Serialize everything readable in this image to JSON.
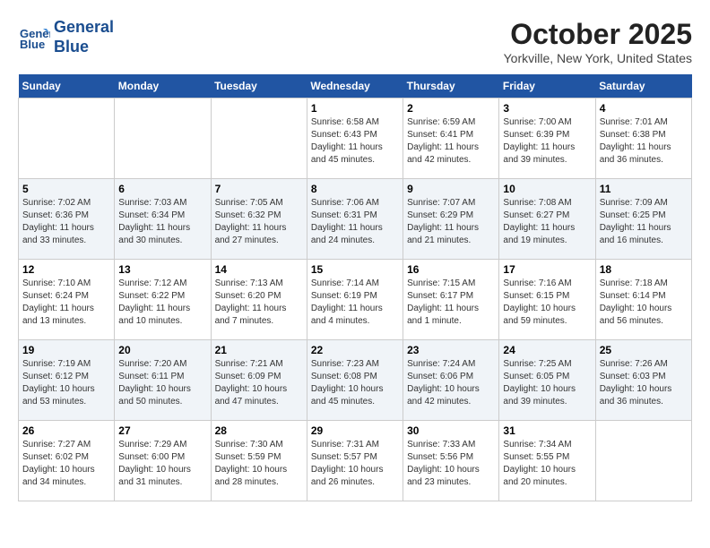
{
  "header": {
    "logo_line1": "General",
    "logo_line2": "Blue",
    "month": "October 2025",
    "location": "Yorkville, New York, United States"
  },
  "days_of_week": [
    "Sunday",
    "Monday",
    "Tuesday",
    "Wednesday",
    "Thursday",
    "Friday",
    "Saturday"
  ],
  "weeks": [
    [
      {
        "day": "",
        "info": ""
      },
      {
        "day": "",
        "info": ""
      },
      {
        "day": "",
        "info": ""
      },
      {
        "day": "1",
        "info": "Sunrise: 6:58 AM\nSunset: 6:43 PM\nDaylight: 11 hours\nand 45 minutes."
      },
      {
        "day": "2",
        "info": "Sunrise: 6:59 AM\nSunset: 6:41 PM\nDaylight: 11 hours\nand 42 minutes."
      },
      {
        "day": "3",
        "info": "Sunrise: 7:00 AM\nSunset: 6:39 PM\nDaylight: 11 hours\nand 39 minutes."
      },
      {
        "day": "4",
        "info": "Sunrise: 7:01 AM\nSunset: 6:38 PM\nDaylight: 11 hours\nand 36 minutes."
      }
    ],
    [
      {
        "day": "5",
        "info": "Sunrise: 7:02 AM\nSunset: 6:36 PM\nDaylight: 11 hours\nand 33 minutes."
      },
      {
        "day": "6",
        "info": "Sunrise: 7:03 AM\nSunset: 6:34 PM\nDaylight: 11 hours\nand 30 minutes."
      },
      {
        "day": "7",
        "info": "Sunrise: 7:05 AM\nSunset: 6:32 PM\nDaylight: 11 hours\nand 27 minutes."
      },
      {
        "day": "8",
        "info": "Sunrise: 7:06 AM\nSunset: 6:31 PM\nDaylight: 11 hours\nand 24 minutes."
      },
      {
        "day": "9",
        "info": "Sunrise: 7:07 AM\nSunset: 6:29 PM\nDaylight: 11 hours\nand 21 minutes."
      },
      {
        "day": "10",
        "info": "Sunrise: 7:08 AM\nSunset: 6:27 PM\nDaylight: 11 hours\nand 19 minutes."
      },
      {
        "day": "11",
        "info": "Sunrise: 7:09 AM\nSunset: 6:25 PM\nDaylight: 11 hours\nand 16 minutes."
      }
    ],
    [
      {
        "day": "12",
        "info": "Sunrise: 7:10 AM\nSunset: 6:24 PM\nDaylight: 11 hours\nand 13 minutes."
      },
      {
        "day": "13",
        "info": "Sunrise: 7:12 AM\nSunset: 6:22 PM\nDaylight: 11 hours\nand 10 minutes."
      },
      {
        "day": "14",
        "info": "Sunrise: 7:13 AM\nSunset: 6:20 PM\nDaylight: 11 hours\nand 7 minutes."
      },
      {
        "day": "15",
        "info": "Sunrise: 7:14 AM\nSunset: 6:19 PM\nDaylight: 11 hours\nand 4 minutes."
      },
      {
        "day": "16",
        "info": "Sunrise: 7:15 AM\nSunset: 6:17 PM\nDaylight: 11 hours\nand 1 minute."
      },
      {
        "day": "17",
        "info": "Sunrise: 7:16 AM\nSunset: 6:15 PM\nDaylight: 10 hours\nand 59 minutes."
      },
      {
        "day": "18",
        "info": "Sunrise: 7:18 AM\nSunset: 6:14 PM\nDaylight: 10 hours\nand 56 minutes."
      }
    ],
    [
      {
        "day": "19",
        "info": "Sunrise: 7:19 AM\nSunset: 6:12 PM\nDaylight: 10 hours\nand 53 minutes."
      },
      {
        "day": "20",
        "info": "Sunrise: 7:20 AM\nSunset: 6:11 PM\nDaylight: 10 hours\nand 50 minutes."
      },
      {
        "day": "21",
        "info": "Sunrise: 7:21 AM\nSunset: 6:09 PM\nDaylight: 10 hours\nand 47 minutes."
      },
      {
        "day": "22",
        "info": "Sunrise: 7:23 AM\nSunset: 6:08 PM\nDaylight: 10 hours\nand 45 minutes."
      },
      {
        "day": "23",
        "info": "Sunrise: 7:24 AM\nSunset: 6:06 PM\nDaylight: 10 hours\nand 42 minutes."
      },
      {
        "day": "24",
        "info": "Sunrise: 7:25 AM\nSunset: 6:05 PM\nDaylight: 10 hours\nand 39 minutes."
      },
      {
        "day": "25",
        "info": "Sunrise: 7:26 AM\nSunset: 6:03 PM\nDaylight: 10 hours\nand 36 minutes."
      }
    ],
    [
      {
        "day": "26",
        "info": "Sunrise: 7:27 AM\nSunset: 6:02 PM\nDaylight: 10 hours\nand 34 minutes."
      },
      {
        "day": "27",
        "info": "Sunrise: 7:29 AM\nSunset: 6:00 PM\nDaylight: 10 hours\nand 31 minutes."
      },
      {
        "day": "28",
        "info": "Sunrise: 7:30 AM\nSunset: 5:59 PM\nDaylight: 10 hours\nand 28 minutes."
      },
      {
        "day": "29",
        "info": "Sunrise: 7:31 AM\nSunset: 5:57 PM\nDaylight: 10 hours\nand 26 minutes."
      },
      {
        "day": "30",
        "info": "Sunrise: 7:33 AM\nSunset: 5:56 PM\nDaylight: 10 hours\nand 23 minutes."
      },
      {
        "day": "31",
        "info": "Sunrise: 7:34 AM\nSunset: 5:55 PM\nDaylight: 10 hours\nand 20 minutes."
      },
      {
        "day": "",
        "info": ""
      }
    ]
  ]
}
